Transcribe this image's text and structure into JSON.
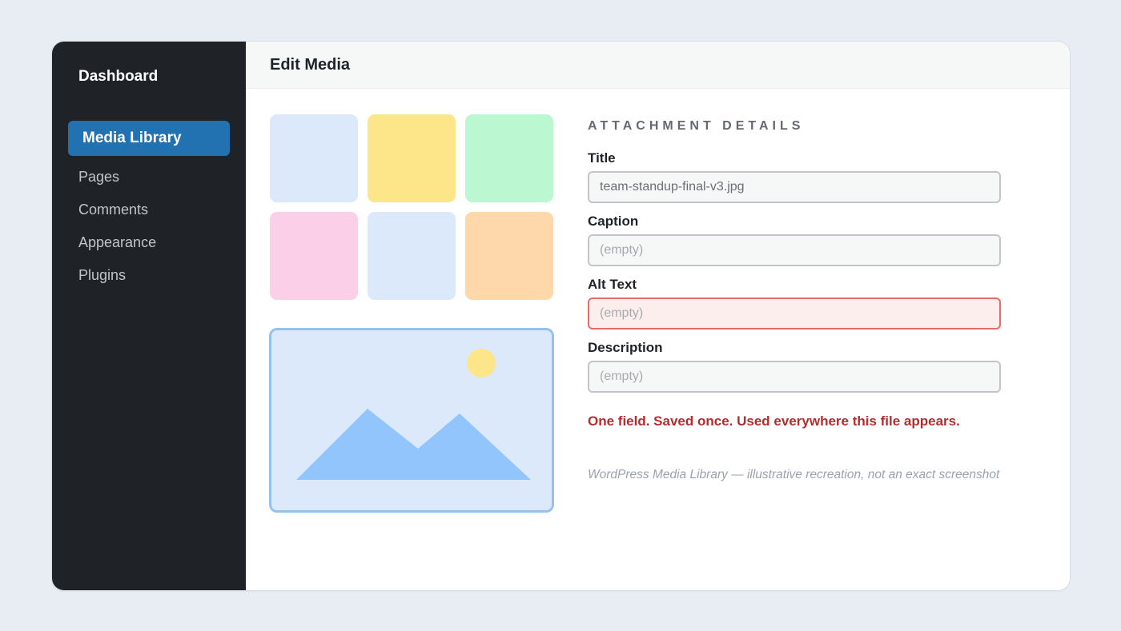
{
  "sidebar": {
    "brand": "Dashboard",
    "active_item": "Media Library",
    "items": [
      "Pages",
      "Comments",
      "Appearance",
      "Plugins"
    ]
  },
  "header": {
    "title": "Edit Media"
  },
  "thumbnails": {
    "colors": [
      "#dbe9fb",
      "#fde68a",
      "#bbf7d0",
      "#fbcfe8",
      "#dbe9fb",
      "#fed7aa"
    ]
  },
  "preview": {
    "background": "#dbe9fb",
    "mountain_color": "#93c5fd",
    "sun_color": "#fde68a"
  },
  "details": {
    "section_title": "ATTACHMENT DETAILS",
    "fields": [
      {
        "label": "Title",
        "value": "team-standup-final-v3.jpg",
        "placeholder": ""
      },
      {
        "label": "Caption",
        "value": "",
        "placeholder": "(empty)"
      },
      {
        "label": "Alt Text",
        "value": "",
        "placeholder": "(empty)"
      },
      {
        "label": "Description",
        "value": "",
        "placeholder": "(empty)"
      }
    ],
    "callout": "One field. Saved once. Used everywhere this file appears.",
    "footnote": "WordPress Media Library — illustrative recreation, not an exact screenshot"
  },
  "colors": {
    "sidebar_bg": "#1f2327",
    "accent": "#2271b1",
    "error": "#b32d2e",
    "error_border": "#e06c6c"
  }
}
